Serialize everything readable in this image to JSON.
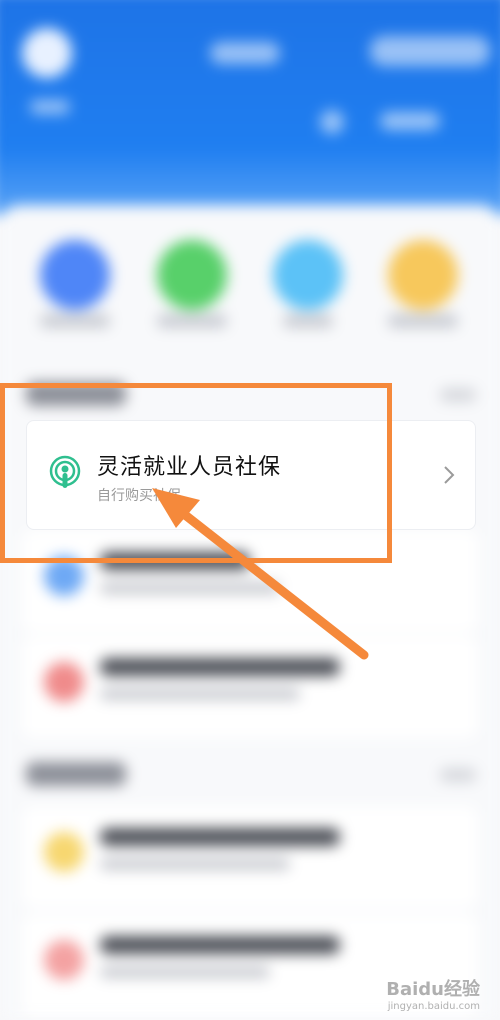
{
  "card": {
    "title": "灵活就业人员社保",
    "subtitle": "自行购买社保",
    "icon": "podcast-signal-icon",
    "chevron": "chevron-right-icon"
  },
  "watermark": {
    "brand": "Baidu经验",
    "url": "jingyan.baidu.com"
  },
  "colors": {
    "header_blue": "#1e73e6",
    "highlight_orange": "#f5893b",
    "icon_green": "#2fbf8f"
  }
}
